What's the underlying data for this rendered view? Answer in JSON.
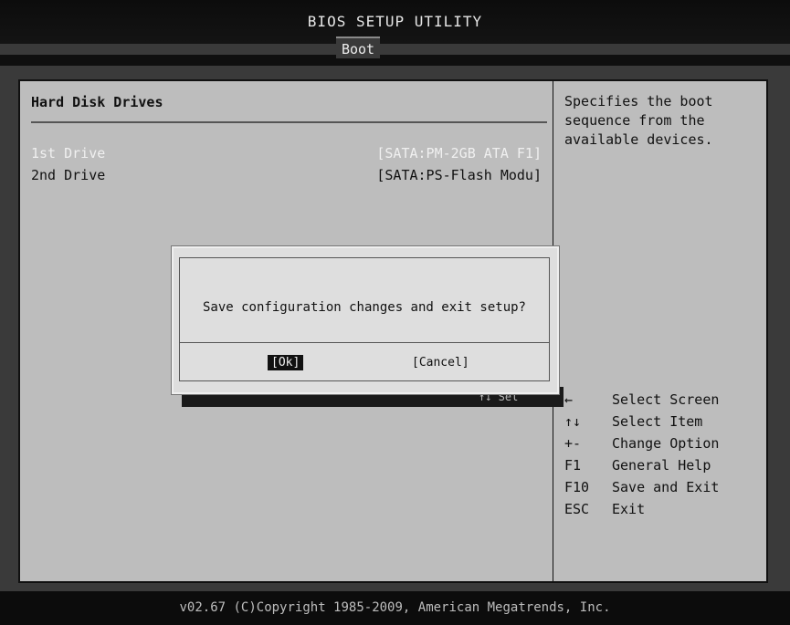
{
  "header": {
    "title": "BIOS SETUP UTILITY",
    "active_tab": "Boot"
  },
  "main": {
    "section_title": "Hard Disk Drives",
    "drives": [
      {
        "label": "1st Drive",
        "value": "[SATA:PM-2GB ATA F1]"
      },
      {
        "label": "2nd Drive",
        "value": "[SATA:PS-Flash Modu]"
      }
    ]
  },
  "help": {
    "text": "Specifies the boot sequence from the available devices.",
    "keys": [
      {
        "key": "←",
        "desc": "Select Screen"
      },
      {
        "key": "↑↓",
        "desc": "Select Item"
      },
      {
        "key": "+-",
        "desc": "Change Option"
      },
      {
        "key": "F1",
        "desc": "General Help"
      },
      {
        "key": "F10",
        "desc": "Save and Exit"
      },
      {
        "key": "ESC",
        "desc": "Exit"
      }
    ]
  },
  "dialog": {
    "message": "Save configuration changes and exit setup?",
    "ok_label": "[Ok]",
    "cancel_label": "[Cancel]",
    "underlay_text": "↑↓  Sel"
  },
  "footer": {
    "text": "v02.67 (C)Copyright 1985-2009, American Megatrends, Inc."
  }
}
